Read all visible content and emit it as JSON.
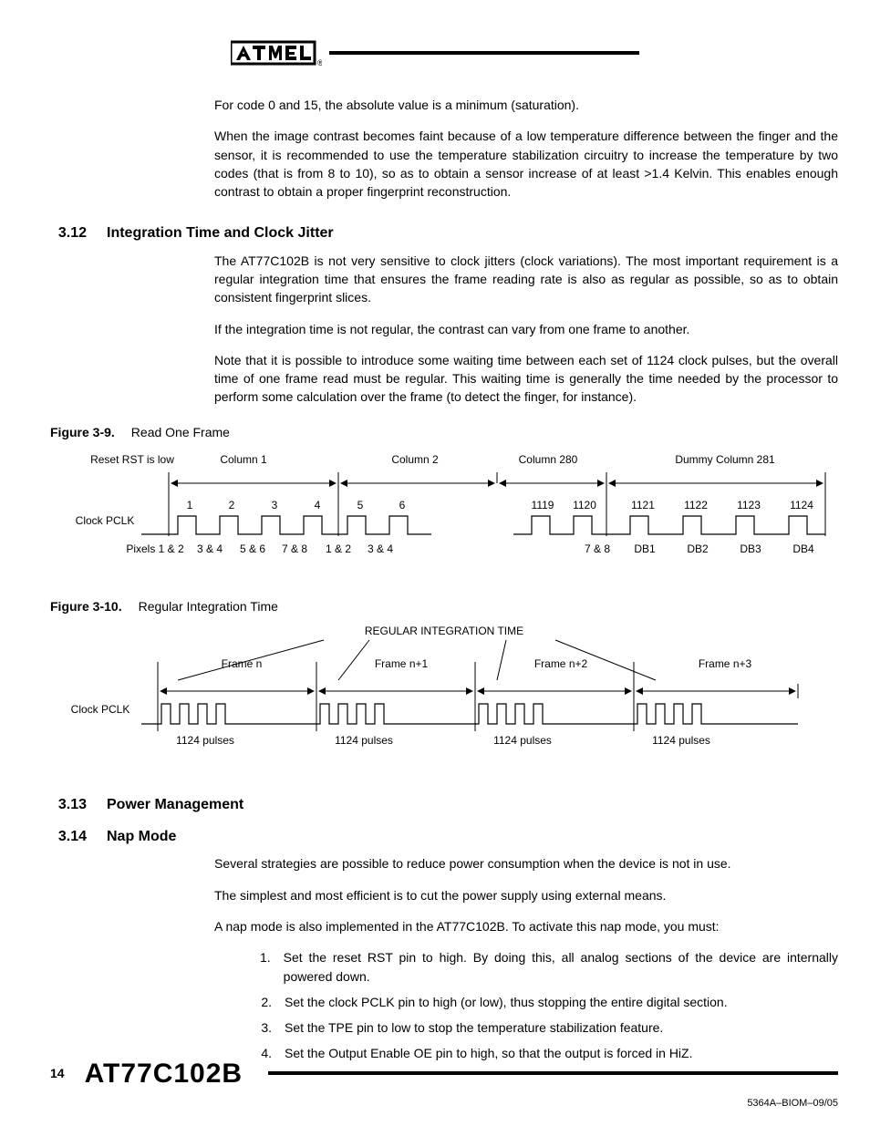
{
  "paragraphs": {
    "p1": "For code 0 and 15, the absolute value is a minimum (saturation).",
    "p2": "When the image contrast becomes faint because of a low temperature difference between the finger and the sensor, it is recommended to use the temperature stabilization circuitry to increase the temperature by two codes (that is from 8 to 10), so as to obtain a sensor increase of at least >1.4 Kelvin. This enables enough contrast to obtain a proper fingerprint reconstruction.",
    "p3": "The AT77C102B is not very sensitive to clock jitters (clock variations). The most important requirement is a regular integration time that ensures the frame reading rate is also as regular as possible, so as to obtain consistent fingerprint slices.",
    "p4": "If the integration time is not regular, the contrast can vary from one frame to another.",
    "p5": "Note that it is possible to introduce some waiting time between each set of 1124 clock pulses, but the overall time of one frame read must be regular. This waiting time is generally the time needed by the processor to perform some calculation over the frame (to detect the finger, for instance).",
    "p6": "Several strategies are possible to reduce power consumption when the device is not in use.",
    "p7": "The simplest and most efficient is to cut the power supply using external means.",
    "p8": "A nap mode is also implemented in the AT77C102B. To activate this nap mode, you must:"
  },
  "sections": {
    "s312": {
      "num": "3.12",
      "title": "Integration Time and Clock Jitter"
    },
    "s313": {
      "num": "3.13",
      "title": "Power Management"
    },
    "s314": {
      "num": "3.14",
      "title": "Nap Mode"
    }
  },
  "figures": {
    "f39": {
      "num": "Figure 3-9.",
      "title": "Read One Frame"
    },
    "f310": {
      "num": "Figure 3-10.",
      "title": "Regular Integration Time"
    }
  },
  "list": {
    "i1": "Set the reset RST pin to high. By doing this, all analog sections of the device are internally powered down.",
    "i2": "Set the clock PCLK pin to high (or low), thus stopping the entire digital section.",
    "i3": "Set the TPE pin to low to stop the temperature stabilization feature.",
    "i4": "Set the Output Enable OE pin to high, so that the output is forced in HiZ."
  },
  "chart_data": [
    {
      "type": "timing-diagram",
      "figure": "3-9",
      "title": "Read One Frame",
      "signal": "Clock PCLK",
      "reset_label": "Reset RST is low",
      "columns": [
        {
          "label": "Column 1",
          "clock_numbers": [
            1,
            2,
            3,
            4
          ],
          "pixel_labels": [
            "Pixels 1 & 2",
            "3 & 4",
            "5 & 6",
            "7 & 8"
          ]
        },
        {
          "label": "Column 2",
          "clock_numbers": [
            5,
            6
          ],
          "pixel_labels": [
            "1 & 2",
            "3 & 4"
          ]
        },
        {
          "label": "Column 280",
          "clock_numbers": [
            1119,
            1120
          ],
          "pixel_labels": [
            "7 & 8"
          ]
        },
        {
          "label": "Dummy Column 281",
          "clock_numbers": [
            1121,
            1122,
            1123,
            1124
          ],
          "pixel_labels": [
            "DB1",
            "DB2",
            "DB3",
            "DB4"
          ]
        }
      ]
    },
    {
      "type": "timing-diagram",
      "figure": "3-10",
      "title": "Regular Integration Time",
      "header_label": "REGULAR INTEGRATION TIME",
      "signal": "Clock PCLK",
      "frames": [
        {
          "label": "Frame n",
          "pulses": "1124 pulses"
        },
        {
          "label": "Frame n+1",
          "pulses": "1124 pulses"
        },
        {
          "label": "Frame n+2",
          "pulses": "1124 pulses"
        },
        {
          "label": "Frame n+3",
          "pulses": "1124 pulses"
        }
      ]
    }
  ],
  "footer": {
    "page": "14",
    "doc": "AT77C102B",
    "code": "5364A–BIOM–09/05"
  }
}
